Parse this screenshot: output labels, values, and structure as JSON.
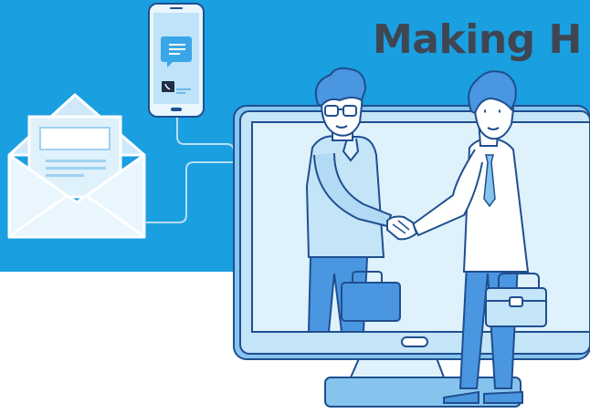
{
  "headline": "Making H",
  "colors": {
    "background_band": "#1a9fe0",
    "page_background": "#ffffff",
    "outline": "#1f4f8f",
    "light_blue": "#dff1fb",
    "mid_blue": "#86c4ee",
    "accent_blue": "#4a96e0",
    "headline_text": "#3f4652"
  },
  "icons": [
    "smartphone-icon",
    "chat-bubble-icon",
    "phone-call-icon",
    "envelope-icon",
    "monitor-icon",
    "handshake-icon",
    "briefcase-icon",
    "glasses-icon",
    "necktie-icon"
  ]
}
